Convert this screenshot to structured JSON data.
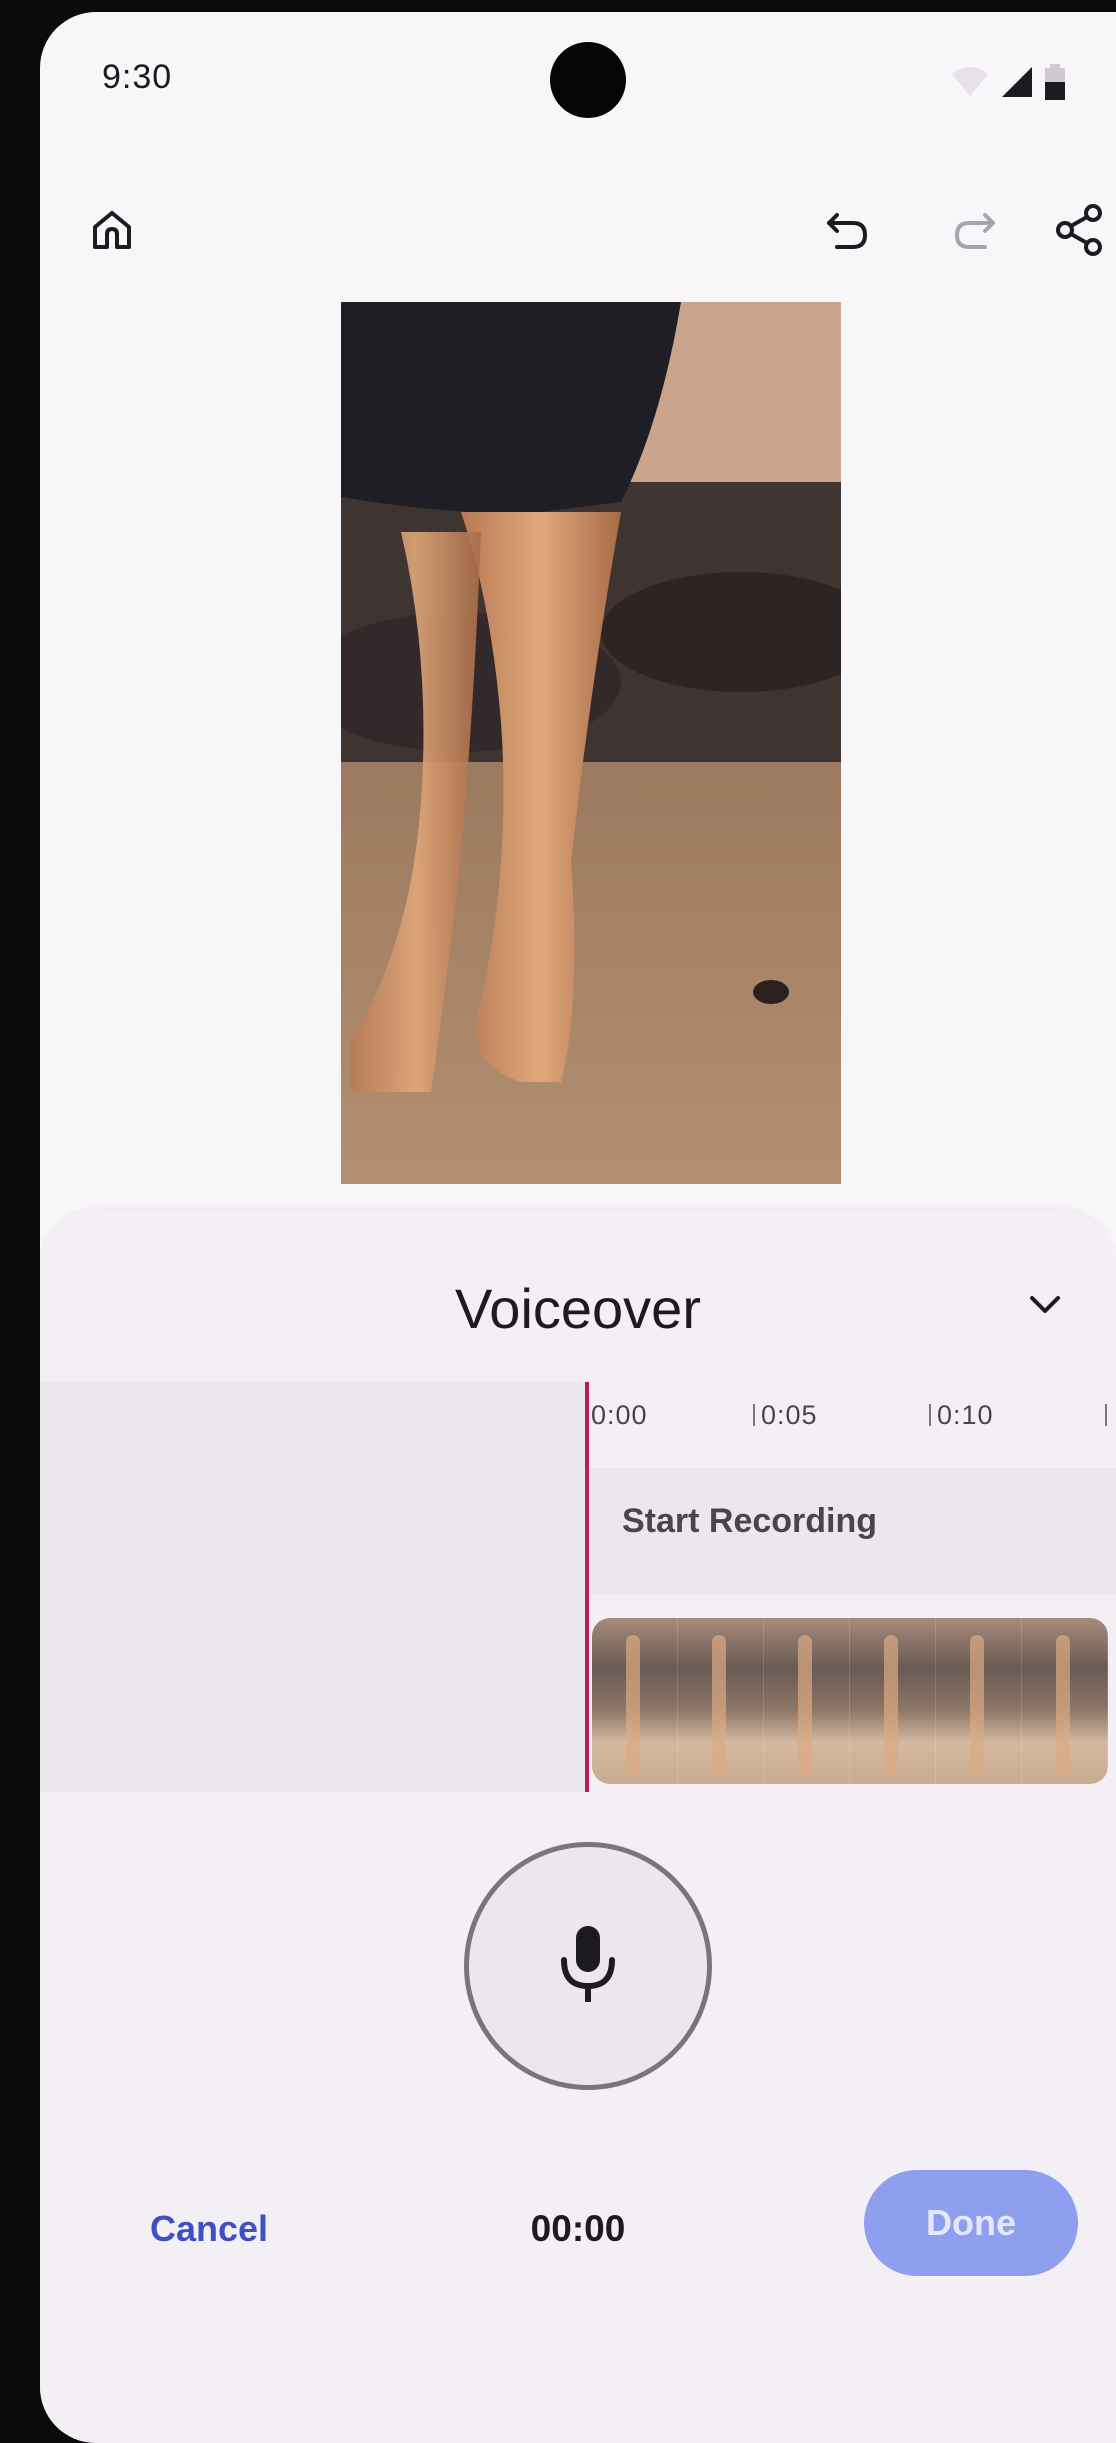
{
  "status_bar": {
    "time": "9:30",
    "icons": [
      "wifi-icon",
      "signal-icon",
      "battery-icon"
    ]
  },
  "app_bar": {
    "icons": [
      "home-icon",
      "undo-icon",
      "redo-icon",
      "share-icon"
    ],
    "redo_enabled": false
  },
  "sheet": {
    "title": "Voiceover",
    "collapse_icon": "chevron-down-icon",
    "timeline": {
      "ticks": [
        "0:00",
        "0:05",
        "0:10"
      ],
      "record_label": "Start Recording",
      "frame_count": 6
    },
    "mic_icon": "microphone-icon",
    "cancel_label": "Cancel",
    "timer": "00:00",
    "done_label": "Done",
    "done_enabled": false
  },
  "colors": {
    "accent": "#3d50c4",
    "done_disabled_bg": "#8f9ff0",
    "playhead": "#b3225a",
    "sheet_bg": "#f3eff4",
    "page_bg": "#f9f6fa"
  }
}
